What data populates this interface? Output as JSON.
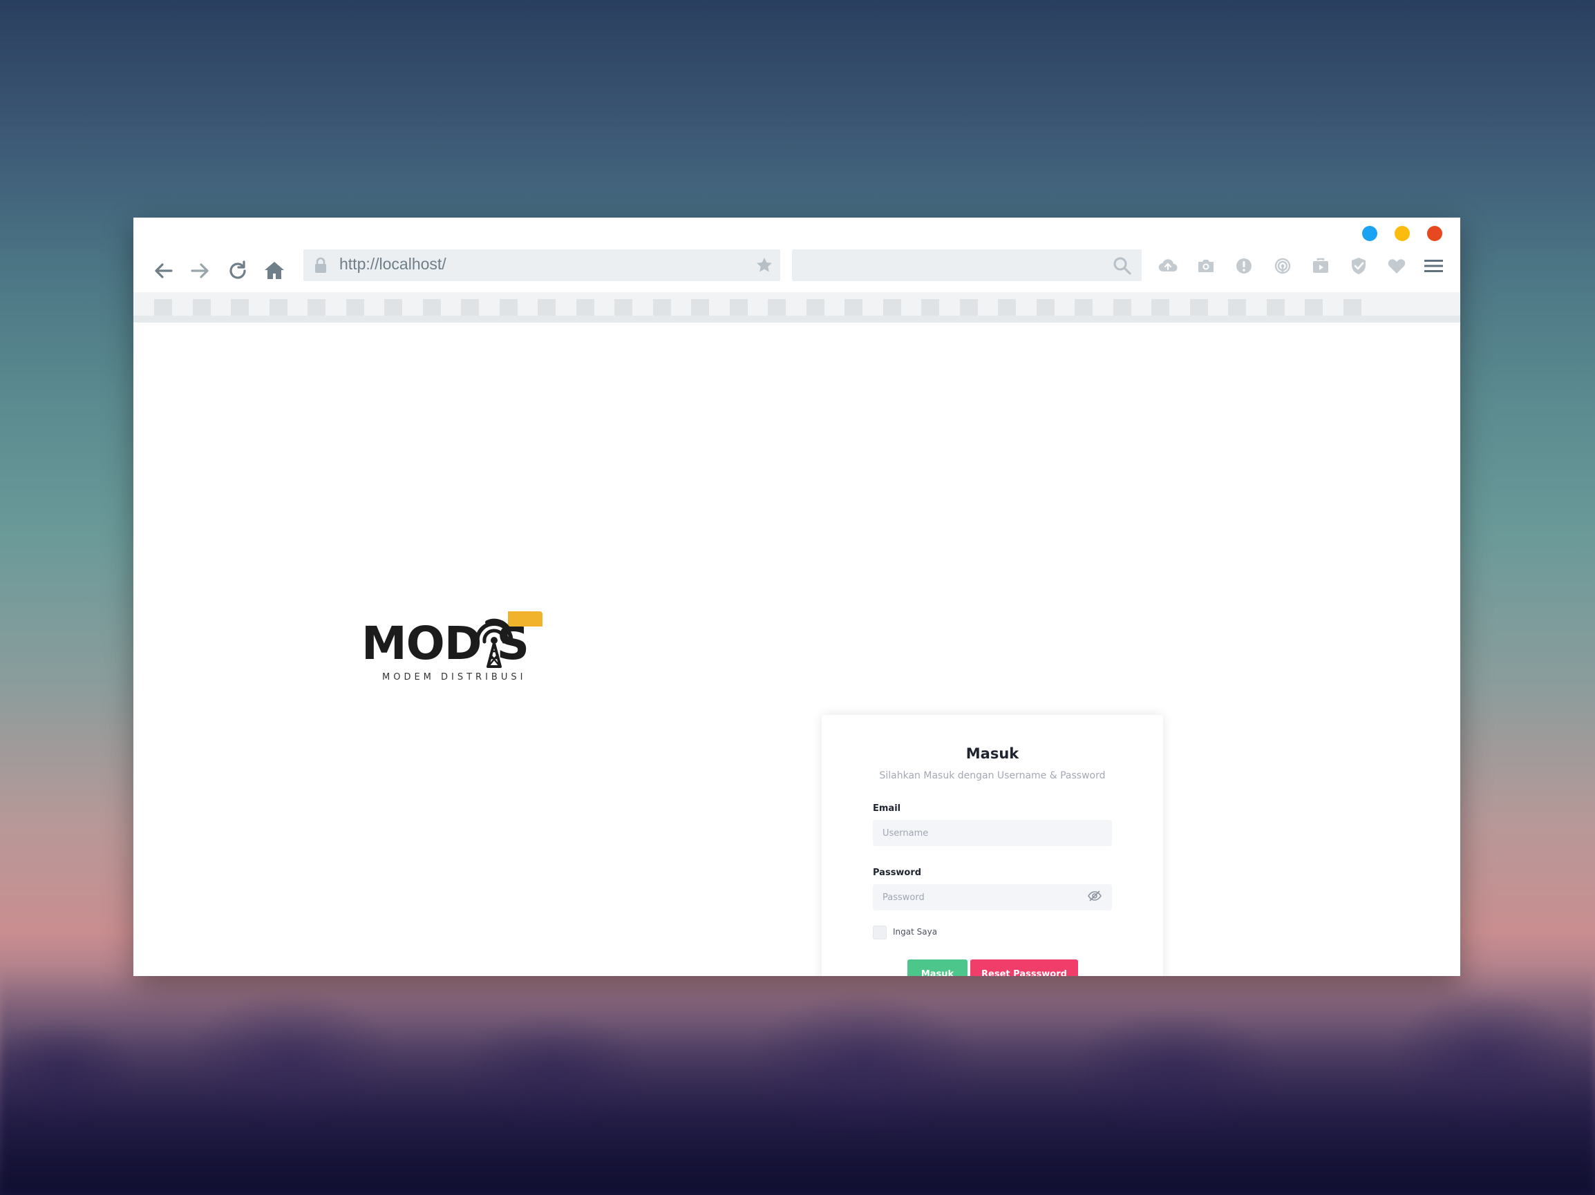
{
  "window": {
    "controls": [
      {
        "name": "minimize",
        "color": "#1aa3f2"
      },
      {
        "name": "maximize",
        "color": "#fcbb0f"
      },
      {
        "name": "close",
        "color": "#e8481f"
      }
    ]
  },
  "toolbar": {
    "url": "http://localhost/",
    "icons": [
      "back-arrow-icon",
      "forward-arrow-icon",
      "reload-icon",
      "home-icon",
      "lock-icon",
      "bookmark-star-icon",
      "search-icon",
      "cloud-upload-icon",
      "camera-icon",
      "alert-icon",
      "broadcast-icon",
      "briefcase-icon",
      "shield-check-icon",
      "heart-icon",
      "hamburger-menu-icon"
    ]
  },
  "logo": {
    "word": "MOD S",
    "subtitle": "MODEM DISTRIBUSI",
    "colors": {
      "text": "#1c1c1c",
      "accent": "#f2b32c"
    }
  },
  "login": {
    "title": "Masuk",
    "subtitle": "Silahkan Masuk dengan Username & Password",
    "email_label": "Email",
    "email_placeholder": "Username",
    "email_value": "",
    "password_label": "Password",
    "password_placeholder": "Password",
    "password_value": "",
    "remember_label": "Ingat Saya",
    "remember_checked": false,
    "submit_label": "Masuk",
    "reset_label": "Reset Passsword",
    "colors": {
      "submit": "#4cc68a",
      "reset": "#f03d6a"
    }
  }
}
